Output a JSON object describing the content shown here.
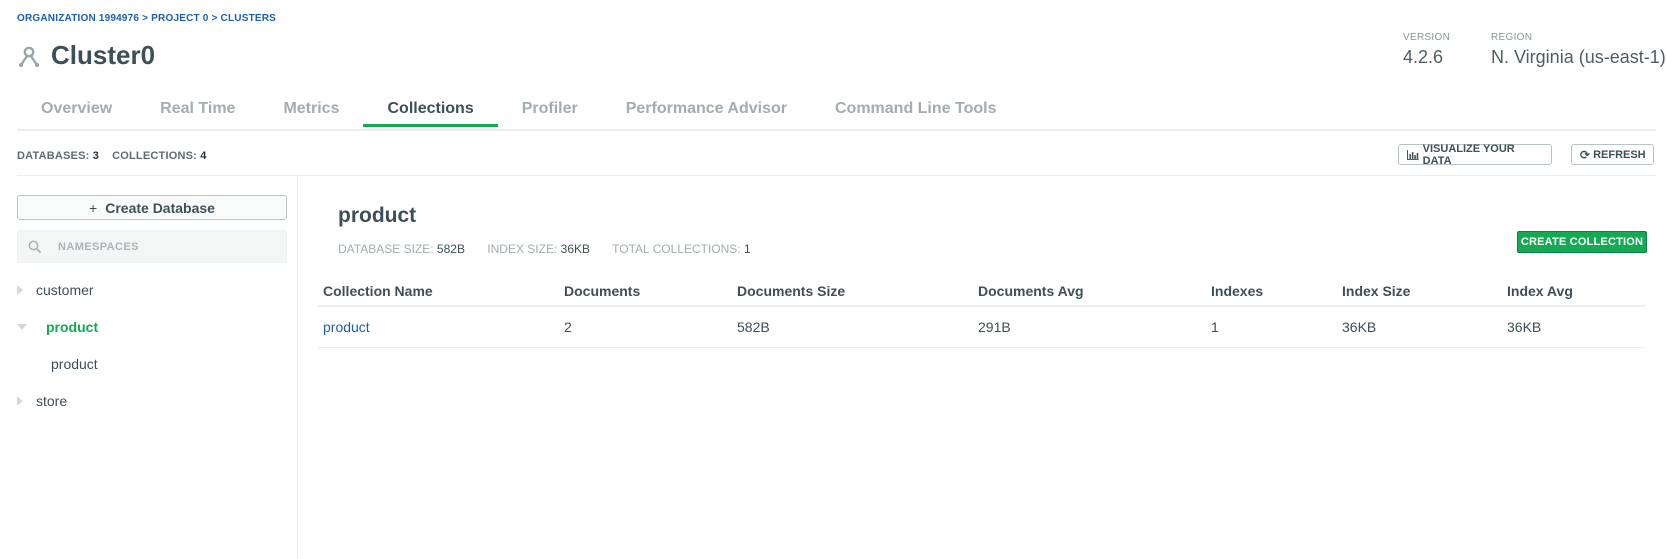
{
  "breadcrumb": "ORGANIZATION 1994976 > PROJECT 0 > CLUSTERS",
  "cluster": {
    "title": "Cluster0",
    "icon": "cluster-icon"
  },
  "meta": {
    "version_label": "VERSION",
    "version_value": "4.2.6",
    "region_label": "REGION",
    "region_value": "N. Virginia (us-east-1)"
  },
  "tabs": [
    {
      "label": "Overview",
      "active": false
    },
    {
      "label": "Real Time",
      "active": false
    },
    {
      "label": "Metrics",
      "active": false
    },
    {
      "label": "Collections",
      "active": true
    },
    {
      "label": "Profiler",
      "active": false
    },
    {
      "label": "Performance Advisor",
      "active": false
    },
    {
      "label": "Command Line Tools",
      "active": false
    }
  ],
  "stats": {
    "databases_label": "DATABASES:",
    "databases_value": "3",
    "collections_label": "COLLECTIONS:",
    "collections_value": "4"
  },
  "toolbar": {
    "visualize_label": "VISUALIZE YOUR DATA",
    "refresh_label": "REFRESH"
  },
  "sidebar": {
    "create_db_label": "Create Database",
    "search_placeholder": "NAMESPACES",
    "tree": [
      {
        "label": "customer",
        "expanded": false
      },
      {
        "label": "product",
        "expanded": true,
        "children": [
          "product"
        ]
      },
      {
        "label": "store",
        "expanded": false
      }
    ]
  },
  "main": {
    "db_name": "product",
    "db_size_label": "DATABASE SIZE:",
    "db_size_value": "582B",
    "index_size_label": "INDEX SIZE:",
    "index_size_value": "36KB",
    "total_collections_label": "TOTAL COLLECTIONS:",
    "total_collections_value": "1",
    "create_collection_label": "CREATE COLLECTION",
    "table": {
      "headers": [
        "Collection Name",
        "Documents",
        "Documents Size",
        "Documents Avg",
        "Indexes",
        "Index Size",
        "Index Avg"
      ],
      "rows": [
        [
          "product",
          "2",
          "582B",
          "291B",
          "1",
          "36KB",
          "36KB"
        ]
      ]
    }
  },
  "colors": {
    "accent": "#13aa52",
    "link": "#1a5fb4"
  }
}
